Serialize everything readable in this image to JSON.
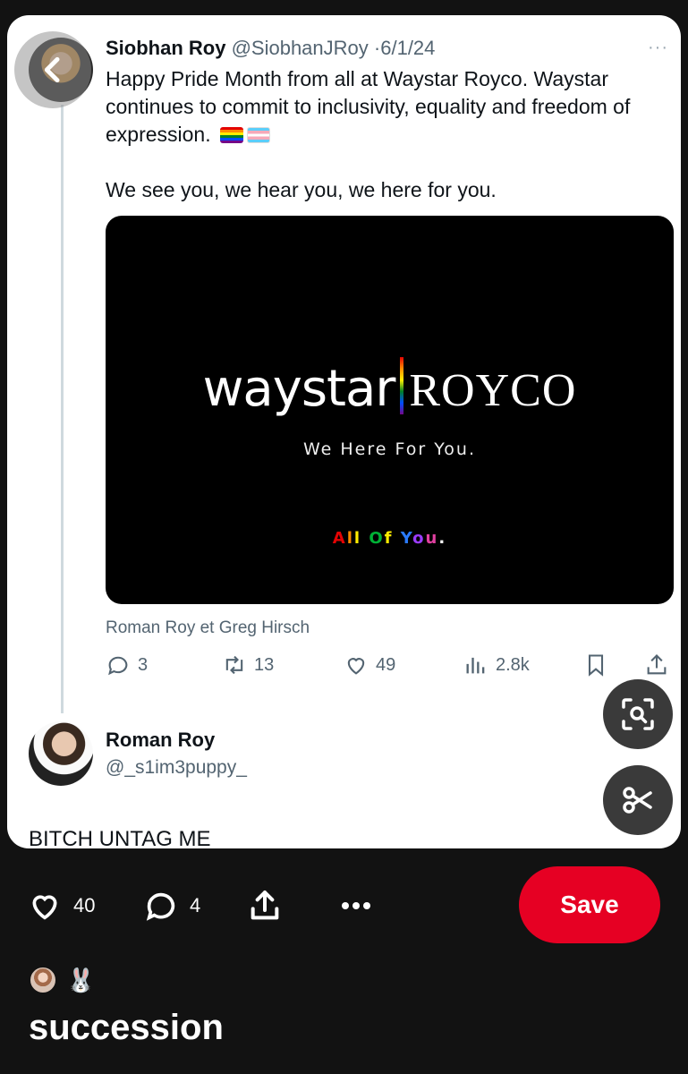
{
  "tweet": {
    "author_name": "Siobhan Roy",
    "author_handle": "@SiobhanJRoy",
    "separator": "·",
    "date": "6/1/24",
    "more": "···",
    "text_line1": "Happy Pride Month from all at Waystar Royco. Waystar continues to commit to inclusivity, equality and freedom of expression.",
    "text_line2": "We see you, we hear you, we here for you.",
    "media": {
      "logo_left": "waystar",
      "logo_right": "ROYCO",
      "tagline": "We Here For You.",
      "footer_letters": [
        "A",
        "l",
        "l",
        " ",
        "O",
        "f",
        " ",
        "Y",
        "o",
        "u",
        "."
      ],
      "footer_colors": [
        "#e40303",
        "#ff8c00",
        "#ffed00",
        "#ffffff",
        "#00b035",
        "#ffed00",
        "#ffffff",
        "#2a7bff",
        "#9b3cff",
        "#e040a0",
        "#ffffff"
      ]
    },
    "tagged": "Roman Roy et Greg Hirsch",
    "stats": {
      "replies": "3",
      "retweets": "13",
      "likes": "49",
      "views": "2.8k"
    }
  },
  "reply": {
    "name": "Roman Roy",
    "handle": "@_s1im3puppy_",
    "text": "BITCH UNTAG ME"
  },
  "pin_actions": {
    "likes": "40",
    "comments": "4",
    "save_label": "Save"
  },
  "profile": {
    "emoji": "🐰"
  },
  "board_title": "succession",
  "icons": {
    "back": "chevron-left-icon",
    "visual_search": "visual-search-icon",
    "scissors": "scissors-icon"
  },
  "colors": {
    "save_button": "#e60023",
    "background": "#121212"
  }
}
